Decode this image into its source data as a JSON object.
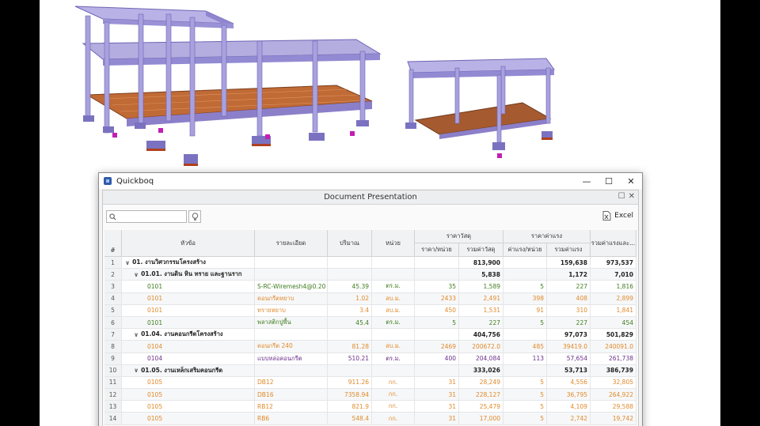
{
  "window": {
    "title": "Quickboq",
    "minimize": "—",
    "maximize": "☐",
    "close": "✕"
  },
  "panel": {
    "title": "Document Presentation",
    "restore": "☐",
    "close": "✕"
  },
  "toolbar": {
    "search_placeholder": "",
    "excel_label": "Excel"
  },
  "colors": {
    "accent": "#2f5aa8",
    "green": "#3e7d1e",
    "orange": "#e08a2b",
    "purple": "#6b2f8a"
  },
  "headers": {
    "num": "#",
    "topic": "หัวข้อ",
    "detail": "รายละเอียด",
    "qty": "ปริมาณ",
    "unit": "หน่วย",
    "material": "ราคาวัสดุ",
    "mat_unit": "ราคา/หน่วย",
    "mat_total": "รวมค่าวัสดุ",
    "labor": "ราคาค่าแรง",
    "lab_unit": "ค่าแรง/หน่วย",
    "lab_total": "รวมค่าแรง",
    "grand": "รวมค่าแรงและ..."
  },
  "rows": [
    {
      "n": "1",
      "topic": "01. งานวิศวกรรมโครงสร้าง",
      "detail": "",
      "qty": "",
      "unit": "",
      "mu": "",
      "mt": "813,900",
      "lu": "",
      "lt": "159,638",
      "g": "973,537",
      "lvl": 0,
      "color": ""
    },
    {
      "n": "2",
      "topic": "01.01. งานดิน หิน ทราย และฐานราก",
      "detail": "",
      "qty": "",
      "unit": "",
      "mu": "",
      "mt": "5,838",
      "lu": "",
      "lt": "1,172",
      "g": "7,010",
      "lvl": 1,
      "color": ""
    },
    {
      "n": "3",
      "topic": "0101",
      "detail": "S-RC-Wiremesh4@0.20",
      "qty": "45.39",
      "unit": "ตร.ม.",
      "mu": "35",
      "mt": "1,589",
      "lu": "5",
      "lt": "227",
      "g": "1,816",
      "lvl": 2,
      "color": "green"
    },
    {
      "n": "4",
      "topic": "0101",
      "detail": "คอนกรีตหยาบ",
      "qty": "1.02",
      "unit": "ลบ.ม.",
      "mu": "2433",
      "mt": "2,491",
      "lu": "398",
      "lt": "408",
      "g": "2,899",
      "lvl": 2,
      "color": "orange"
    },
    {
      "n": "5",
      "topic": "0101",
      "detail": "ทรายหยาบ",
      "qty": "3.4",
      "unit": "ลบ.ม.",
      "mu": "450",
      "mt": "1,531",
      "lu": "91",
      "lt": "310",
      "g": "1,841",
      "lvl": 2,
      "color": "orange"
    },
    {
      "n": "6",
      "topic": "0101",
      "detail": "พลาสติกปูพื้น",
      "qty": "45.4",
      "unit": "ตร.ม.",
      "mu": "5",
      "mt": "227",
      "lu": "5",
      "lt": "227",
      "g": "454",
      "lvl": 2,
      "color": "green"
    },
    {
      "n": "7",
      "topic": "01.04. งานคอนกรีตโครงสร้าง",
      "detail": "",
      "qty": "",
      "unit": "",
      "mu": "",
      "mt": "404,756",
      "lu": "",
      "lt": "97,073",
      "g": "501,829",
      "lvl": 1,
      "color": ""
    },
    {
      "n": "8",
      "topic": "0104",
      "detail": "คอนกรีต 240",
      "qty": "81.28",
      "unit": "ลบ.ม.",
      "mu": "2469",
      "mt": "200672.0",
      "lu": "485",
      "lt": "39419.0",
      "g": "240091.0",
      "lvl": 2,
      "color": "orange"
    },
    {
      "n": "9",
      "topic": "0104",
      "detail": "แบบหล่อคอนกรีต",
      "qty": "510.21",
      "unit": "ตร.ม.",
      "mu": "400",
      "mt": "204,084",
      "lu": "113",
      "lt": "57,654",
      "g": "261,738",
      "lvl": 2,
      "color": "purple"
    },
    {
      "n": "10",
      "topic": "01.05. งานเหล็กเสริมคอนกรีต",
      "detail": "",
      "qty": "",
      "unit": "",
      "mu": "",
      "mt": "333,026",
      "lu": "",
      "lt": "53,713",
      "g": "386,739",
      "lvl": 1,
      "color": ""
    },
    {
      "n": "11",
      "topic": "0105",
      "detail": "DB12",
      "qty": "911.26",
      "unit": "กก.",
      "mu": "31",
      "mt": "28,249",
      "lu": "5",
      "lt": "4,556",
      "g": "32,805",
      "lvl": 2,
      "color": "orange"
    },
    {
      "n": "12",
      "topic": "0105",
      "detail": "DB16",
      "qty": "7358.94",
      "unit": "กก.",
      "mu": "31",
      "mt": "228,127",
      "lu": "5",
      "lt": "36,795",
      "g": "264,922",
      "lvl": 2,
      "color": "orange"
    },
    {
      "n": "13",
      "topic": "0105",
      "detail": "RB12",
      "qty": "821.9",
      "unit": "กก.",
      "mu": "31",
      "mt": "25,479",
      "lu": "5",
      "lt": "4,109",
      "g": "29,588",
      "lvl": 2,
      "color": "orange"
    },
    {
      "n": "14",
      "topic": "0105",
      "detail": "RB6",
      "qty": "548.4",
      "unit": "กก.",
      "mu": "31",
      "mt": "17,000",
      "lu": "5",
      "lt": "2,742",
      "g": "19,742",
      "lvl": 2,
      "color": "orange"
    }
  ]
}
